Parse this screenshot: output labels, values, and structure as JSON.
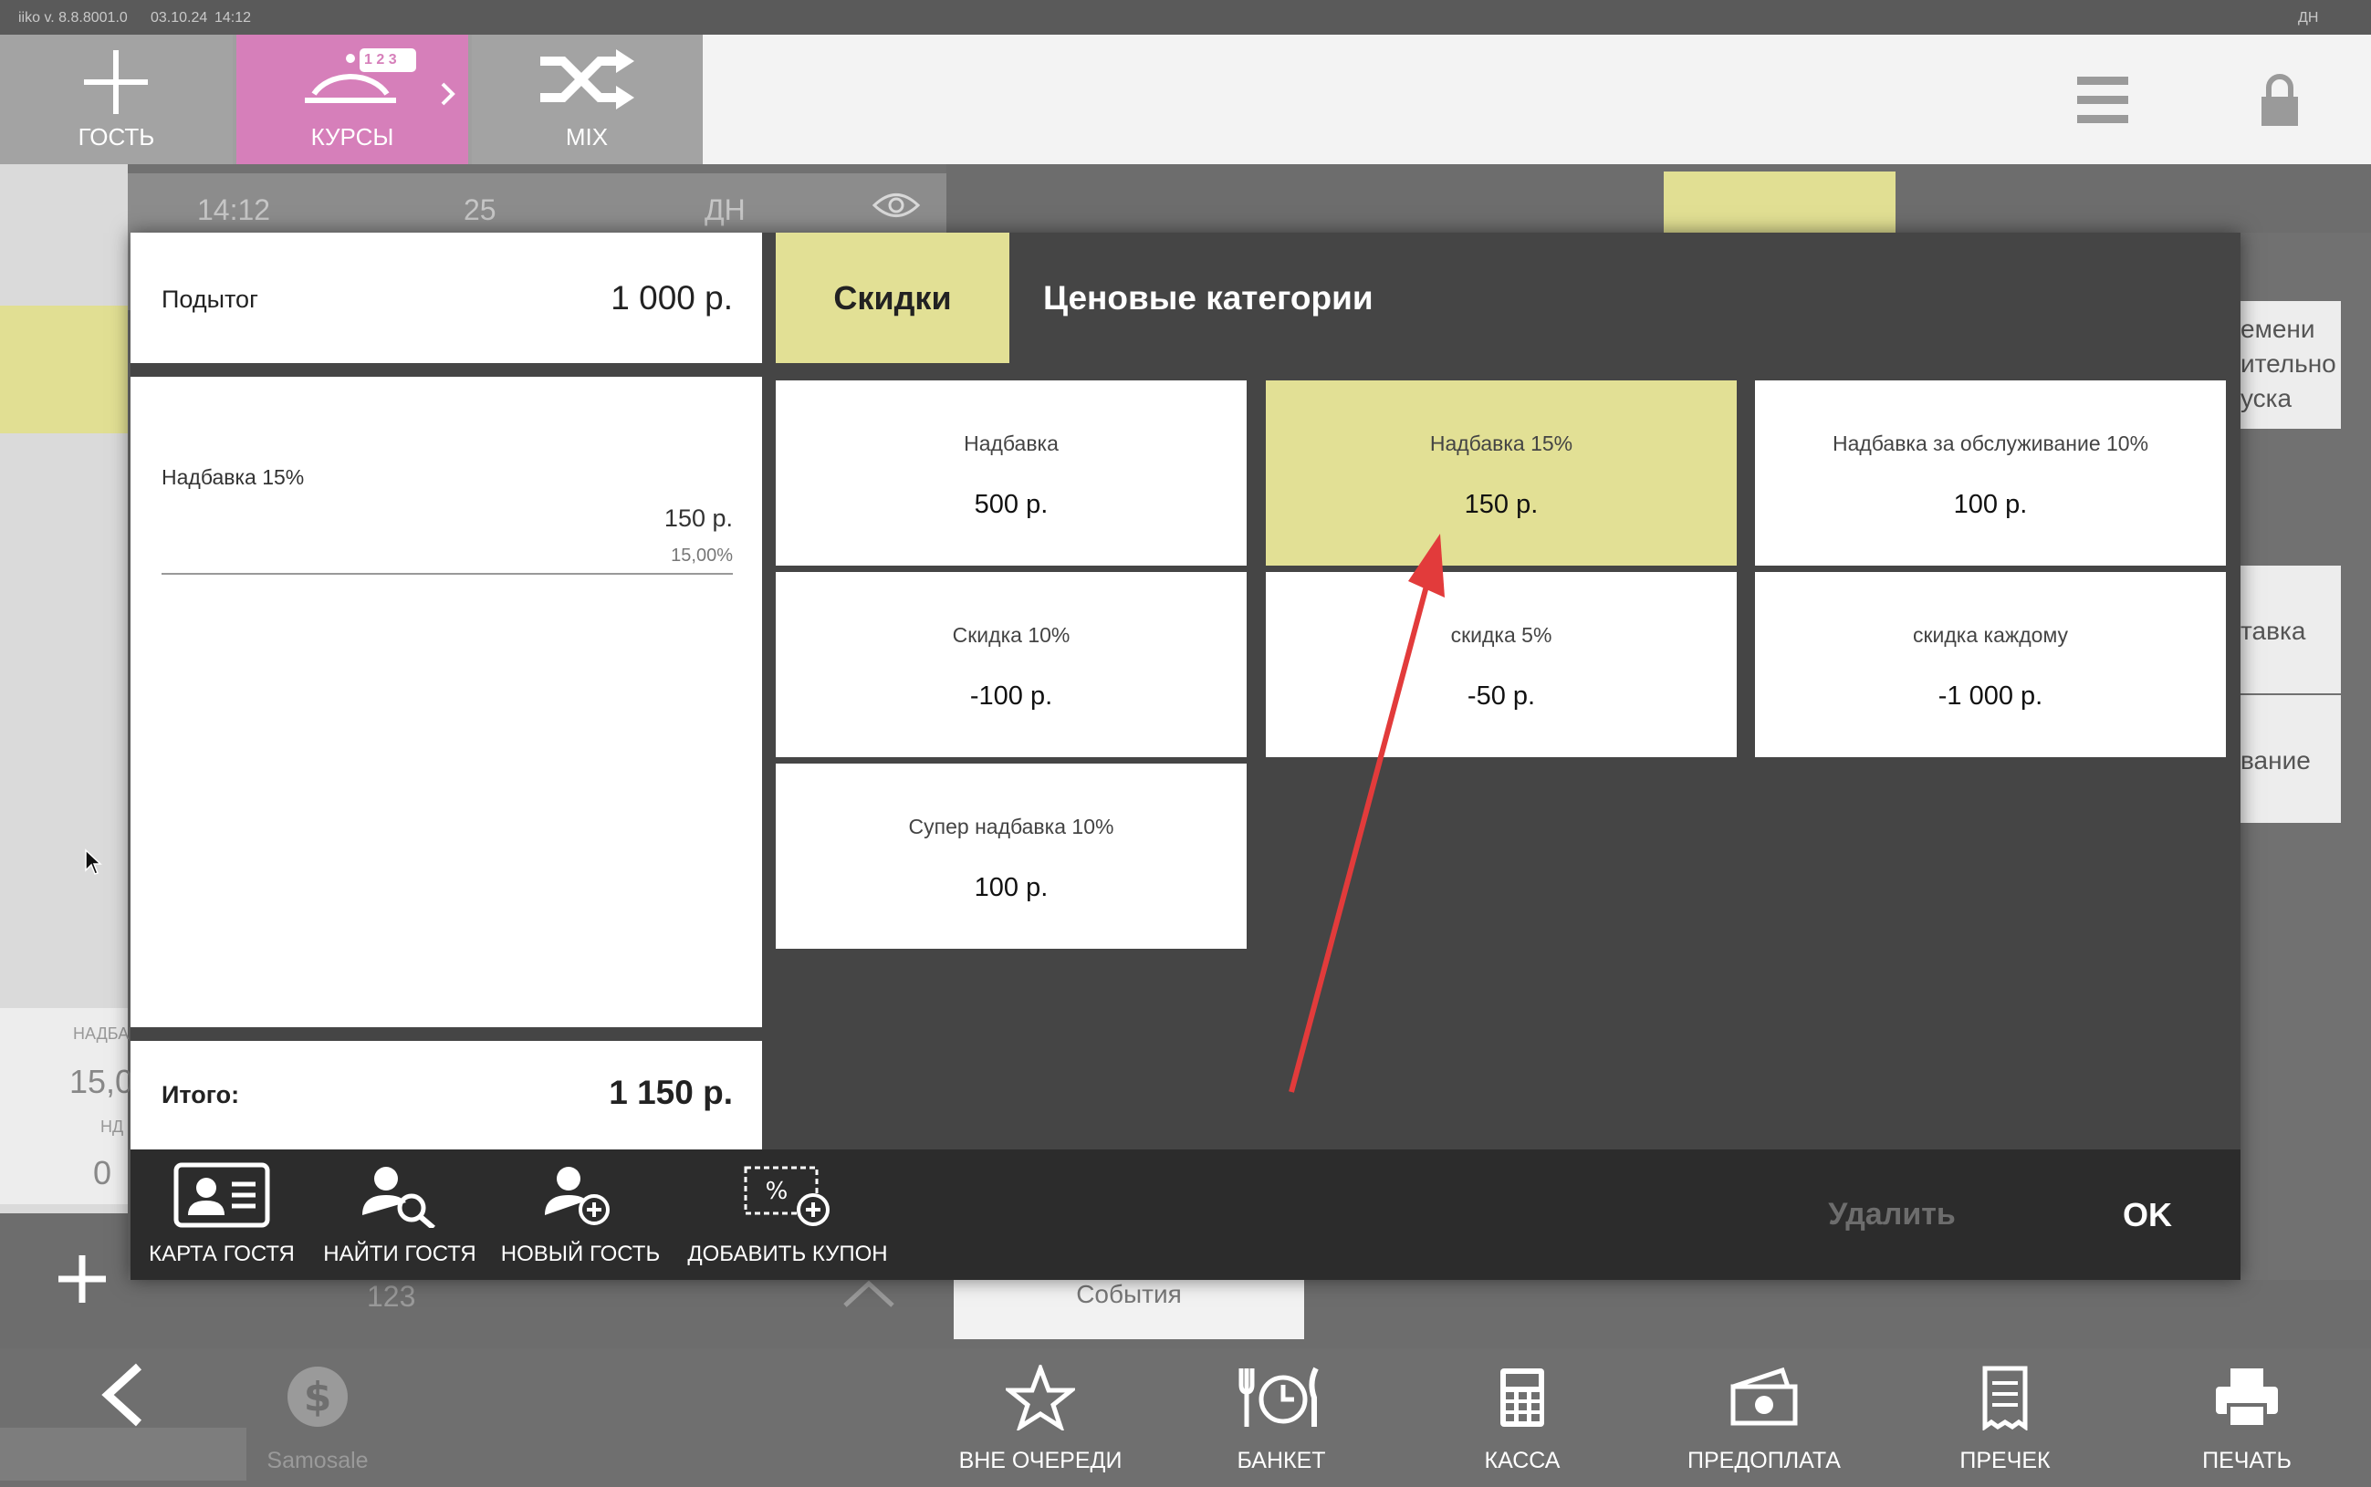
{
  "status_bar": {
    "app_version": "iiko v. 8.8.8001.0",
    "date": "03.10.24",
    "time": "14:12",
    "user_initials": "ДН"
  },
  "top_toolbar": {
    "guest_label": "ГОСТЬ",
    "courses_label": "КУРСЫ",
    "courses_badge": "1 2 3",
    "mix_label": "MIX"
  },
  "order_header": {
    "time": "14:12",
    "table": "25",
    "waiter": "ДН"
  },
  "background": {
    "side_text_1": "емени",
    "side_text_2": "ительно",
    "side_text_3": "уска",
    "side_text_4": "тавка",
    "side_text_5": "вание",
    "left_small_label": "НАДБА",
    "left_value": "15,0",
    "left_small_label_2": "НД",
    "left_value_2": "0",
    "events_button": "События",
    "counter": "123"
  },
  "modal": {
    "subtotal_label": "Подытог",
    "subtotal_value": "1 000 р.",
    "applied_items": [
      {
        "name": "Надбавка 15%",
        "amount": "150 р.",
        "percent": "15,00%"
      }
    ],
    "total_label": "Итого:",
    "total_value": "1 150 р.",
    "tabs": {
      "discounts": "Скидки",
      "price_categories": "Ценовые категории"
    },
    "tiles": [
      {
        "name": "Надбавка",
        "value": "500 р.",
        "selected": false
      },
      {
        "name": "Надбавка 15%",
        "value": "150 р.",
        "selected": true
      },
      {
        "name": "Надбавка за обслуживание 10%",
        "value": "100 р.",
        "selected": false
      },
      {
        "name": "Скидка 10%",
        "value": "-100 р.",
        "selected": false
      },
      {
        "name": "скидка 5%",
        "value": "-50 р.",
        "selected": false
      },
      {
        "name": "скидка каждому",
        "value": "-1 000 р.",
        "selected": false
      },
      {
        "name": "Супер надбавка 10%",
        "value": "100 р.",
        "selected": false
      }
    ],
    "actions": {
      "guest_card": "КАРТА ГОСТЯ",
      "find_guest": "НАЙТИ ГОСТЯ",
      "new_guest": "НОВЫЙ ГОСТЬ",
      "add_coupon": "ДОБАВИТЬ КУПОН",
      "delete": "Удалить",
      "ok": "OK"
    }
  },
  "bottom_bar": {
    "samosale": "Samosale",
    "out_of_turn": "ВНЕ ОЧЕРЕДИ",
    "banquet": "БАНКЕТ",
    "cash": "КАССА",
    "prepayment": "ПРЕДОПЛАТА",
    "precheck": "ПРЕЧЕК",
    "print": "ПЕЧАТЬ"
  },
  "colors": {
    "accent_yellow": "#e2e095",
    "courses_pink": "#d67fba",
    "modal_dark": "#454545",
    "action_bar": "#2c2c2c",
    "arrow_red": "#e23b3b"
  }
}
